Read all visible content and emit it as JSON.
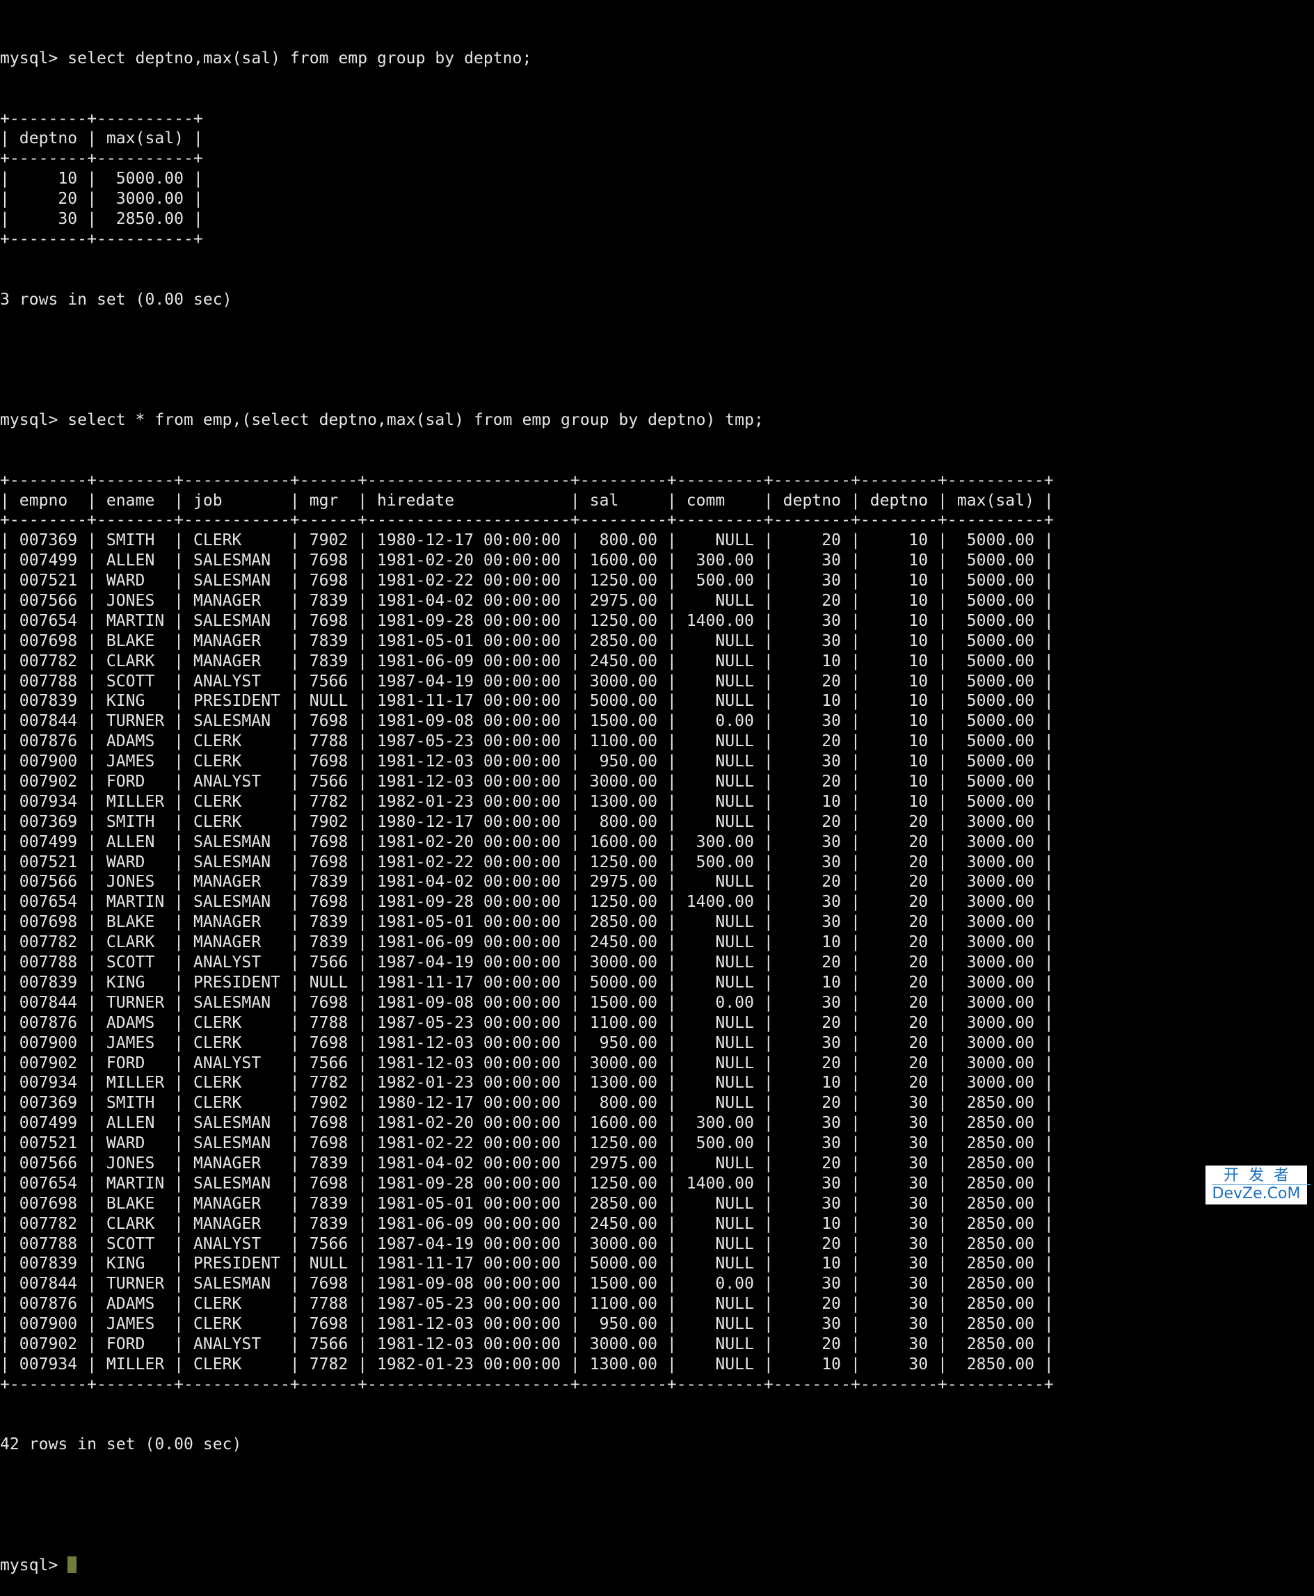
{
  "terminal": {
    "prompt": "mysql> ",
    "query1": {
      "sql": "select deptno,max(sal) from emp group by deptno;",
      "columns": [
        "deptno",
        "max(sal)"
      ],
      "widths": [
        6,
        8
      ],
      "align": [
        "right",
        "right"
      ],
      "rows": [
        [
          "10",
          "5000.00"
        ],
        [
          "20",
          "3000.00"
        ],
        [
          "30",
          "2850.00"
        ]
      ],
      "summary": "3 rows in set (0.00 sec)"
    },
    "query2": {
      "sql": "select * from emp,(select deptno,max(sal) from emp group by deptno) tmp;",
      "columns": [
        "empno",
        "ename",
        "job",
        "mgr",
        "hiredate",
        "sal",
        "comm",
        "deptno",
        "deptno",
        "max(sal)"
      ],
      "widths": [
        6,
        6,
        9,
        4,
        19,
        7,
        7,
        6,
        6,
        8
      ],
      "align": [
        "left",
        "left",
        "left",
        "left",
        "left",
        "right",
        "right",
        "right",
        "right",
        "right"
      ],
      "rows": [
        [
          "007369",
          "SMITH",
          "CLERK",
          "7902",
          "1980-12-17 00:00:00",
          "800.00",
          "NULL",
          "20",
          "10",
          "5000.00"
        ],
        [
          "007499",
          "ALLEN",
          "SALESMAN",
          "7698",
          "1981-02-20 00:00:00",
          "1600.00",
          "300.00",
          "30",
          "10",
          "5000.00"
        ],
        [
          "007521",
          "WARD",
          "SALESMAN",
          "7698",
          "1981-02-22 00:00:00",
          "1250.00",
          "500.00",
          "30",
          "10",
          "5000.00"
        ],
        [
          "007566",
          "JONES",
          "MANAGER",
          "7839",
          "1981-04-02 00:00:00",
          "2975.00",
          "NULL",
          "20",
          "10",
          "5000.00"
        ],
        [
          "007654",
          "MARTIN",
          "SALESMAN",
          "7698",
          "1981-09-28 00:00:00",
          "1250.00",
          "1400.00",
          "30",
          "10",
          "5000.00"
        ],
        [
          "007698",
          "BLAKE",
          "MANAGER",
          "7839",
          "1981-05-01 00:00:00",
          "2850.00",
          "NULL",
          "30",
          "10",
          "5000.00"
        ],
        [
          "007782",
          "CLARK",
          "MANAGER",
          "7839",
          "1981-06-09 00:00:00",
          "2450.00",
          "NULL",
          "10",
          "10",
          "5000.00"
        ],
        [
          "007788",
          "SCOTT",
          "ANALYST",
          "7566",
          "1987-04-19 00:00:00",
          "3000.00",
          "NULL",
          "20",
          "10",
          "5000.00"
        ],
        [
          "007839",
          "KING",
          "PRESIDENT",
          "NULL",
          "1981-11-17 00:00:00",
          "5000.00",
          "NULL",
          "10",
          "10",
          "5000.00"
        ],
        [
          "007844",
          "TURNER",
          "SALESMAN",
          "7698",
          "1981-09-08 00:00:00",
          "1500.00",
          "0.00",
          "30",
          "10",
          "5000.00"
        ],
        [
          "007876",
          "ADAMS",
          "CLERK",
          "7788",
          "1987-05-23 00:00:00",
          "1100.00",
          "NULL",
          "20",
          "10",
          "5000.00"
        ],
        [
          "007900",
          "JAMES",
          "CLERK",
          "7698",
          "1981-12-03 00:00:00",
          "950.00",
          "NULL",
          "30",
          "10",
          "5000.00"
        ],
        [
          "007902",
          "FORD",
          "ANALYST",
          "7566",
          "1981-12-03 00:00:00",
          "3000.00",
          "NULL",
          "20",
          "10",
          "5000.00"
        ],
        [
          "007934",
          "MILLER",
          "CLERK",
          "7782",
          "1982-01-23 00:00:00",
          "1300.00",
          "NULL",
          "10",
          "10",
          "5000.00"
        ],
        [
          "007369",
          "SMITH",
          "CLERK",
          "7902",
          "1980-12-17 00:00:00",
          "800.00",
          "NULL",
          "20",
          "20",
          "3000.00"
        ],
        [
          "007499",
          "ALLEN",
          "SALESMAN",
          "7698",
          "1981-02-20 00:00:00",
          "1600.00",
          "300.00",
          "30",
          "20",
          "3000.00"
        ],
        [
          "007521",
          "WARD",
          "SALESMAN",
          "7698",
          "1981-02-22 00:00:00",
          "1250.00",
          "500.00",
          "30",
          "20",
          "3000.00"
        ],
        [
          "007566",
          "JONES",
          "MANAGER",
          "7839",
          "1981-04-02 00:00:00",
          "2975.00",
          "NULL",
          "20",
          "20",
          "3000.00"
        ],
        [
          "007654",
          "MARTIN",
          "SALESMAN",
          "7698",
          "1981-09-28 00:00:00",
          "1250.00",
          "1400.00",
          "30",
          "20",
          "3000.00"
        ],
        [
          "007698",
          "BLAKE",
          "MANAGER",
          "7839",
          "1981-05-01 00:00:00",
          "2850.00",
          "NULL",
          "30",
          "20",
          "3000.00"
        ],
        [
          "007782",
          "CLARK",
          "MANAGER",
          "7839",
          "1981-06-09 00:00:00",
          "2450.00",
          "NULL",
          "10",
          "20",
          "3000.00"
        ],
        [
          "007788",
          "SCOTT",
          "ANALYST",
          "7566",
          "1987-04-19 00:00:00",
          "3000.00",
          "NULL",
          "20",
          "20",
          "3000.00"
        ],
        [
          "007839",
          "KING",
          "PRESIDENT",
          "NULL",
          "1981-11-17 00:00:00",
          "5000.00",
          "NULL",
          "10",
          "20",
          "3000.00"
        ],
        [
          "007844",
          "TURNER",
          "SALESMAN",
          "7698",
          "1981-09-08 00:00:00",
          "1500.00",
          "0.00",
          "30",
          "20",
          "3000.00"
        ],
        [
          "007876",
          "ADAMS",
          "CLERK",
          "7788",
          "1987-05-23 00:00:00",
          "1100.00",
          "NULL",
          "20",
          "20",
          "3000.00"
        ],
        [
          "007900",
          "JAMES",
          "CLERK",
          "7698",
          "1981-12-03 00:00:00",
          "950.00",
          "NULL",
          "30",
          "20",
          "3000.00"
        ],
        [
          "007902",
          "FORD",
          "ANALYST",
          "7566",
          "1981-12-03 00:00:00",
          "3000.00",
          "NULL",
          "20",
          "20",
          "3000.00"
        ],
        [
          "007934",
          "MILLER",
          "CLERK",
          "7782",
          "1982-01-23 00:00:00",
          "1300.00",
          "NULL",
          "10",
          "20",
          "3000.00"
        ],
        [
          "007369",
          "SMITH",
          "CLERK",
          "7902",
          "1980-12-17 00:00:00",
          "800.00",
          "NULL",
          "20",
          "30",
          "2850.00"
        ],
        [
          "007499",
          "ALLEN",
          "SALESMAN",
          "7698",
          "1981-02-20 00:00:00",
          "1600.00",
          "300.00",
          "30",
          "30",
          "2850.00"
        ],
        [
          "007521",
          "WARD",
          "SALESMAN",
          "7698",
          "1981-02-22 00:00:00",
          "1250.00",
          "500.00",
          "30",
          "30",
          "2850.00"
        ],
        [
          "007566",
          "JONES",
          "MANAGER",
          "7839",
          "1981-04-02 00:00:00",
          "2975.00",
          "NULL",
          "20",
          "30",
          "2850.00"
        ],
        [
          "007654",
          "MARTIN",
          "SALESMAN",
          "7698",
          "1981-09-28 00:00:00",
          "1250.00",
          "1400.00",
          "30",
          "30",
          "2850.00"
        ],
        [
          "007698",
          "BLAKE",
          "MANAGER",
          "7839",
          "1981-05-01 00:00:00",
          "2850.00",
          "NULL",
          "30",
          "30",
          "2850.00"
        ],
        [
          "007782",
          "CLARK",
          "MANAGER",
          "7839",
          "1981-06-09 00:00:00",
          "2450.00",
          "NULL",
          "10",
          "30",
          "2850.00"
        ],
        [
          "007788",
          "SCOTT",
          "ANALYST",
          "7566",
          "1987-04-19 00:00:00",
          "3000.00",
          "NULL",
          "20",
          "30",
          "2850.00"
        ],
        [
          "007839",
          "KING",
          "PRESIDENT",
          "NULL",
          "1981-11-17 00:00:00",
          "5000.00",
          "NULL",
          "10",
          "30",
          "2850.00"
        ],
        [
          "007844",
          "TURNER",
          "SALESMAN",
          "7698",
          "1981-09-08 00:00:00",
          "1500.00",
          "0.00",
          "30",
          "30",
          "2850.00"
        ],
        [
          "007876",
          "ADAMS",
          "CLERK",
          "7788",
          "1987-05-23 00:00:00",
          "1100.00",
          "NULL",
          "20",
          "30",
          "2850.00"
        ],
        [
          "007900",
          "JAMES",
          "CLERK",
          "7698",
          "1981-12-03 00:00:00",
          "950.00",
          "NULL",
          "30",
          "30",
          "2850.00"
        ],
        [
          "007902",
          "FORD",
          "ANALYST",
          "7566",
          "1981-12-03 00:00:00",
          "3000.00",
          "NULL",
          "20",
          "30",
          "2850.00"
        ],
        [
          "007934",
          "MILLER",
          "CLERK",
          "7782",
          "1982-01-23 00:00:00",
          "1300.00",
          "NULL",
          "10",
          "30",
          "2850.00"
        ]
      ],
      "summary": "42 rows in set (0.00 sec)"
    },
    "cursor_color": "#6e7d3a"
  },
  "watermark": {
    "line1": "开发者",
    "line2": "DevZe.CoM",
    "color": "#1a6fc0"
  }
}
